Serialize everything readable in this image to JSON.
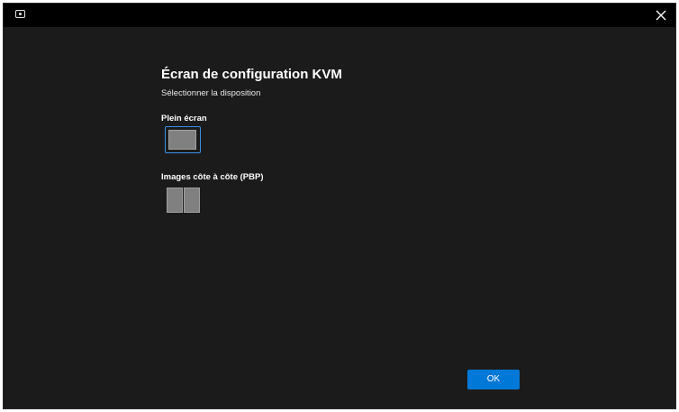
{
  "window": {
    "close_icon": "close-icon",
    "app_icon": "monitor-settings-icon"
  },
  "main": {
    "title": "Écran de configuration KVM",
    "subtitle": "Sélectionner la disposition",
    "layouts": [
      {
        "label": "Plein écran",
        "icon": "full-screen-layout-icon",
        "selected": true
      },
      {
        "label": "Images côte à côte (PBP)",
        "icon": "side-by-side-layout-icon",
        "selected": false
      }
    ]
  },
  "footer": {
    "ok_label": "OK"
  },
  "colors": {
    "background": "#1b1b1b",
    "titlebar": "#000000",
    "accent": "#0078d7",
    "selection_border": "#3a8fe8"
  }
}
